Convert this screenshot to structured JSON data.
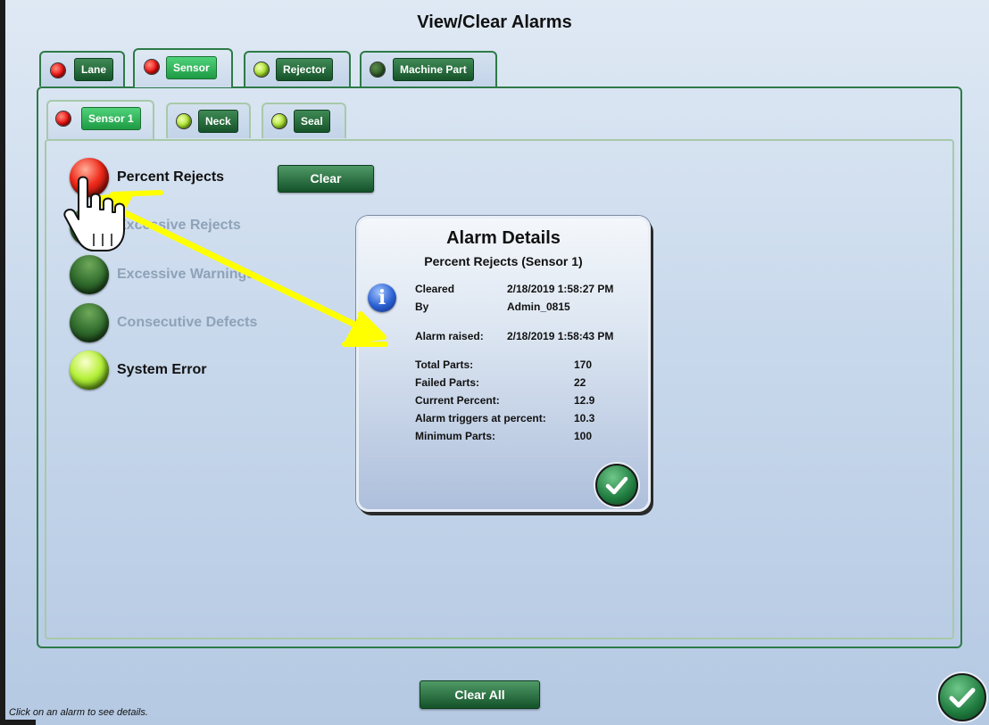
{
  "window": {
    "title": "View/Clear Alarms"
  },
  "top_tabs": [
    {
      "label": "Lane",
      "led": "red"
    },
    {
      "label": "Sensor",
      "led": "red",
      "active": true
    },
    {
      "label": "Rejector",
      "led": "green"
    },
    {
      "label": "Machine Part",
      "led": "dark"
    }
  ],
  "sub_tabs": [
    {
      "label": "Sensor 1",
      "led": "red",
      "active": true
    },
    {
      "label": "Neck",
      "led": "green"
    },
    {
      "label": "Seal",
      "led": "green"
    }
  ],
  "alarms": [
    {
      "label": "Percent Rejects",
      "state": "red"
    },
    {
      "label": "Excessive Rejects",
      "state": "dark"
    },
    {
      "label": "Excessive Warnings",
      "state": "dark"
    },
    {
      "label": "Consecutive Defects",
      "state": "dark"
    },
    {
      "label": "System Error",
      "state": "green"
    }
  ],
  "buttons": {
    "clear": "Clear",
    "clear_all": "Clear All"
  },
  "dialog": {
    "title": "Alarm Details",
    "subtitle": "Percent Rejects  (Sensor 1)",
    "cleared_label": "Cleared",
    "cleared_value": "2/18/2019 1:58:27 PM",
    "by_label": "By",
    "by_value": "Admin_0815",
    "raised_label": "Alarm raised:",
    "raised_value": "2/18/2019 1:58:43 PM",
    "stats": [
      {
        "label": "Total Parts:",
        "value": "170"
      },
      {
        "label": "Failed Parts:",
        "value": "22"
      },
      {
        "label": "Current Percent:",
        "value": "12.9"
      },
      {
        "label": "Alarm triggers at percent:",
        "value": "10.3"
      },
      {
        "label": "Minimum Parts:",
        "value": "100"
      }
    ]
  },
  "status_text": "Click on an alarm to see details.",
  "colors": {
    "accent_green": "#2e7a47",
    "annotation_yellow": "#ffff00"
  }
}
